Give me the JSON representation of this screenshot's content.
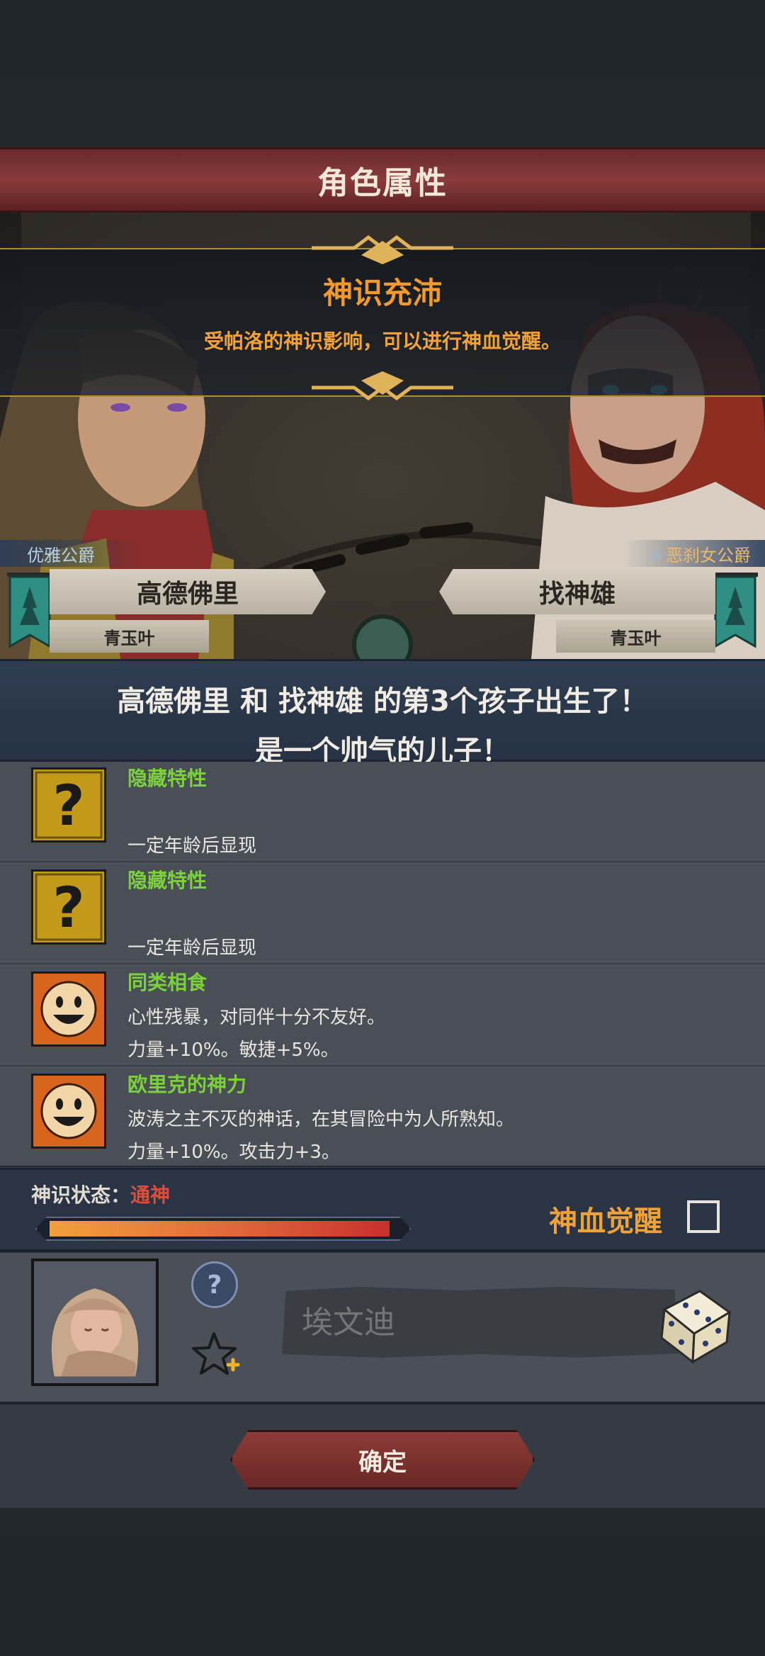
{
  "header": {
    "title": "角色属性"
  },
  "event": {
    "title": "神识充沛",
    "subtitle": "受帕洛的神识影响，可以进行神血觉醒。"
  },
  "father": {
    "rank": "优雅公爵",
    "name": "高德佛里",
    "clan": "青玉叶"
  },
  "mother": {
    "rank": "恶刹女公爵",
    "name": "找神雄",
    "clan": "青玉叶"
  },
  "birth": {
    "line1": "高德佛里 和 找神雄 的第3个孩子出生了！",
    "line2": "是一个帅气的儿子！"
  },
  "traits": [
    {
      "name": "隐藏特性",
      "desc": "",
      "desc2": "一定年龄后显现",
      "icon": "question-mark-icon"
    },
    {
      "name": "隐藏特性",
      "desc": "",
      "desc2": "一定年龄后显现",
      "icon": "question-mark-icon"
    },
    {
      "name": "同类相食",
      "desc": "心性残暴，对同伴十分不友好。",
      "desc2": "力量+10%。敏捷+5%。",
      "icon": "smiley-face-icon"
    },
    {
      "name": "欧里克的神力",
      "desc": "波涛之主不灭的神话，在其冒险中为人所熟知。",
      "desc2": "力量+10%。攻击力+3。",
      "icon": "smiley-face-icon"
    }
  ],
  "divinity": {
    "label": "神识状态：",
    "value": "通神",
    "progress": 0.98,
    "awaken_label": "神血觉醒",
    "awaken_checked": false
  },
  "child": {
    "name_value": "",
    "name_placeholder": "埃文迪"
  },
  "confirm_label": "确定",
  "colors": {
    "accent_orange": "#f39a2a",
    "trait_green": "#7bd13a",
    "divinity_red": "#e04b3a",
    "button_red": "#8c3b37"
  }
}
